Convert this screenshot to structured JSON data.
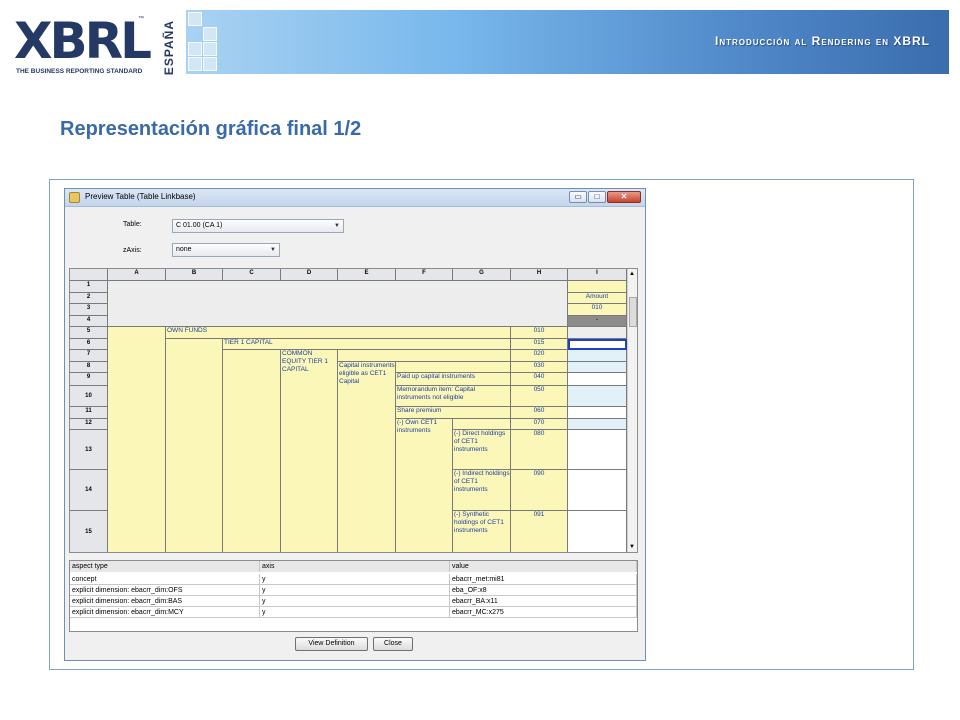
{
  "header": {
    "logo_text": "XBRL",
    "logo_tm": "™",
    "logo_region": "ESPAÑA",
    "logo_tagline": "THE BUSINESS REPORTING STANDARD",
    "title": "Introducción al Rendering en XBRL",
    "colors": {
      "band_light": "#a9d2f2",
      "band_dark": "#3a6dae",
      "logo": "#243a64"
    }
  },
  "slide_title": "Representación gráfica final 1/2",
  "window": {
    "title": "Preview Table (Table Linkbase)",
    "controls": {
      "minimize": "▭",
      "maximize": "□",
      "close": "✕"
    },
    "table_label": "Table:",
    "table_value": "C 01.00 (CA 1)",
    "zaxis_label": "zAxis:",
    "zaxis_value": "none",
    "grid": {
      "columns": [
        "A",
        "B",
        "C",
        "D",
        "E",
        "F",
        "G",
        "H",
        "I"
      ],
      "rows": [
        "1",
        "2",
        "3",
        "4",
        "5",
        "6",
        "7",
        "8",
        "9",
        "10",
        "11",
        "12",
        "13",
        "14",
        "15"
      ],
      "col_header": {
        "amount": "Amount",
        "code": "010",
        "dash": "-"
      },
      "labels": {
        "own_funds": "OWN FUNDS",
        "tier1": "TIER 1 CAPITAL",
        "cet1": "COMMON EQUITY TIER 1 CAPITAL",
        "capital_instruments": "Capital instruments eligible as CET1 Capital",
        "paid_up": "Paid up capital instruments",
        "memorandum": "Memorandum item: Capital instruments not eligible",
        "share_premium": "Share premium",
        "own_cet1": "(-) Own CET1 instruments",
        "direct": "(-) Direct holdings of CET1 instruments",
        "indirect": "(-) Indirect holdings of CET1 instruments",
        "synthetic": "(-) Synthetic holdings of CET1 instruments"
      },
      "codes": [
        "010",
        "015",
        "020",
        "030",
        "040",
        "050",
        "060",
        "070",
        "080",
        "090",
        "091"
      ]
    },
    "properties": {
      "headers": [
        "aspect type",
        "axis",
        "value"
      ],
      "rows": [
        [
          "concept",
          "y",
          "ebacrr_met:mi81"
        ],
        [
          "explicit dimension: ebacrr_dim:OFS",
          "y",
          "eba_OF:x8"
        ],
        [
          "explicit dimension: ebacrr_dim:BAS",
          "y",
          "ebacrr_BA:x11"
        ],
        [
          "explicit dimension: ebacrr_dim:MCY",
          "y",
          "ebacrr_MC:x275"
        ]
      ]
    },
    "buttons": {
      "view_definition": "View Definition",
      "close": "Close"
    },
    "scroll": {
      "up": "▲",
      "down": "▼"
    }
  }
}
